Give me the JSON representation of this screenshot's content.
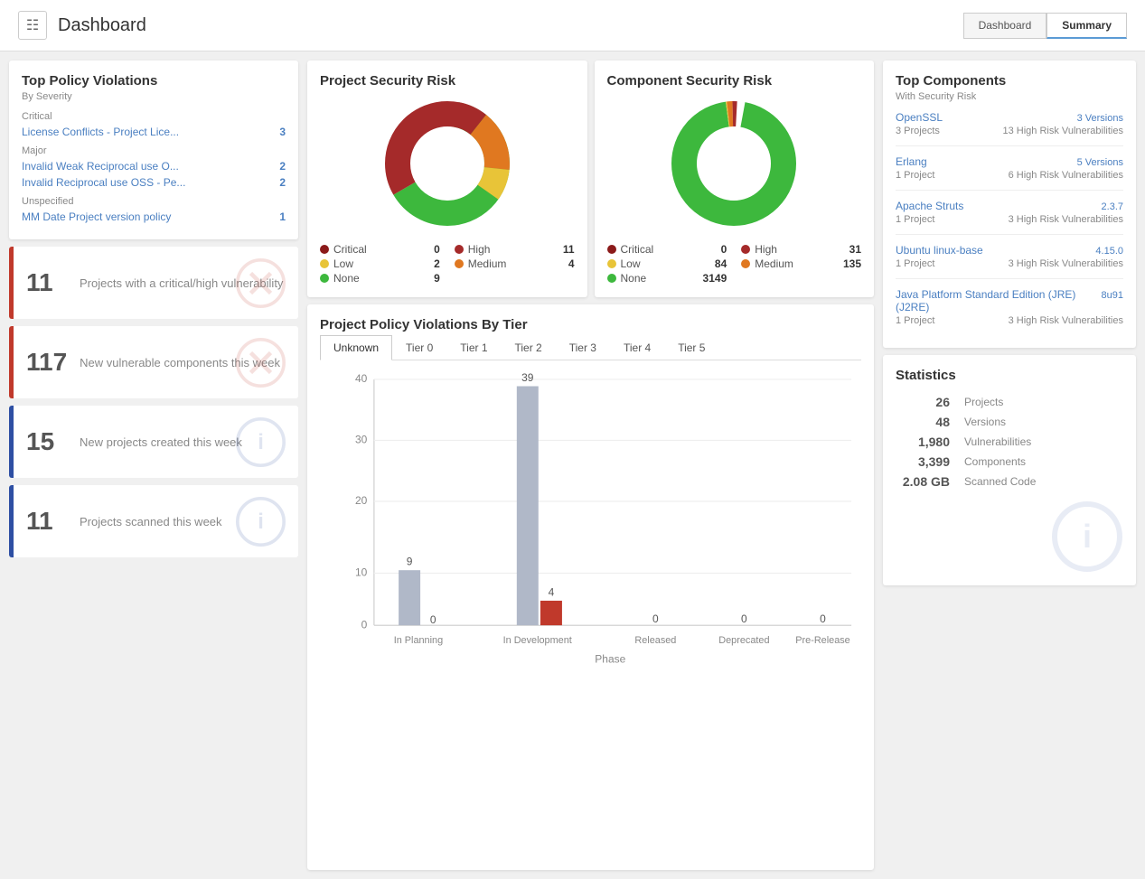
{
  "header": {
    "title": "Dashboard",
    "nav_dashboard": "Dashboard",
    "nav_summary": "Summary"
  },
  "left": {
    "policy_title": "Top Policy Violations",
    "policy_subtitle": "By Severity",
    "severities": [
      {
        "label": "Critical",
        "items": [
          {
            "text": "License Conflicts - Project Lice...",
            "count": "3"
          }
        ]
      },
      {
        "label": "Major",
        "items": [
          {
            "text": "Invalid Weak Reciprocal use O...",
            "count": "2"
          },
          {
            "text": "Invalid Reciprocal use OSS - Pe...",
            "count": "2"
          }
        ]
      },
      {
        "label": "Unspecified",
        "items": [
          {
            "text": "MM Date Project version policy",
            "count": "1"
          }
        ]
      }
    ],
    "stat_cards": [
      {
        "number": "11",
        "label": "Projects with a critical/high vulnerability",
        "type": "red",
        "icon": "x-circle"
      },
      {
        "number": "117",
        "label": "New vulnerable components this week",
        "type": "red",
        "icon": "x-circle"
      },
      {
        "number": "15",
        "label": "New projects created this week",
        "type": "blue",
        "icon": "info-circle"
      },
      {
        "number": "11",
        "label": "Projects scanned this week",
        "type": "blue",
        "icon": "info-circle"
      }
    ]
  },
  "center": {
    "project_risk_title": "Project Security Risk",
    "component_risk_title": "Component Security Risk",
    "project_legend": [
      {
        "color": "#8b1a1a",
        "label": "Critical",
        "value": "0"
      },
      {
        "color": "#a52a2a",
        "label": "High",
        "value": "11"
      },
      {
        "color": "#e8c438",
        "label": "Low",
        "value": "2"
      },
      {
        "color": "#e07820",
        "label": "Medium",
        "value": "4"
      },
      {
        "color": "#3db83d",
        "label": "None",
        "value": "9"
      }
    ],
    "component_legend": [
      {
        "color": "#8b1a1a",
        "label": "Critical",
        "value": "0"
      },
      {
        "color": "#a52a2a",
        "label": "High",
        "value": "31"
      },
      {
        "color": "#e8c438",
        "label": "Low",
        "value": "84"
      },
      {
        "color": "#e07820",
        "label": "Medium",
        "value": "135"
      },
      {
        "color": "#3db83d",
        "label": "None",
        "value": "3149"
      }
    ],
    "violations_title": "Project Policy Violations By Tier",
    "tabs": [
      "Unknown",
      "Tier 0",
      "Tier 1",
      "Tier 2",
      "Tier 3",
      "Tier 4",
      "Tier 5"
    ],
    "active_tab": "Unknown",
    "bar_chart": {
      "y_labels": [
        "0",
        "10",
        "20",
        "30",
        "40"
      ],
      "x_labels": [
        "In Planning",
        "In Development",
        "Released",
        "Deprecated",
        "Pre-Release"
      ],
      "x_sub": "Phase",
      "bars": [
        {
          "phase": "In Planning",
          "gray": 9,
          "red": 0,
          "gray_label": "9",
          "red_label": "0"
        },
        {
          "phase": "In Development",
          "gray": 39,
          "red": 4,
          "gray_label": "39",
          "red_label": "4"
        },
        {
          "phase": "Released",
          "gray": 0,
          "red": 0,
          "gray_label": "0",
          "red_label": ""
        },
        {
          "phase": "Deprecated",
          "gray": 0,
          "red": 0,
          "gray_label": "0",
          "red_label": ""
        },
        {
          "phase": "Pre-Release",
          "gray": 0,
          "red": 0,
          "gray_label": "0",
          "red_label": ""
        }
      ]
    }
  },
  "right": {
    "top_components_title": "Top Components",
    "top_components_subtitle": "With Security Risk",
    "components": [
      {
        "name": "OpenSSL",
        "projects": "3 Projects",
        "version": "3 Versions",
        "vulns": "13 High Risk Vulnerabilities"
      },
      {
        "name": "Erlang",
        "projects": "1 Project",
        "version": "5 Versions",
        "vulns": "6 High Risk Vulnerabilities"
      },
      {
        "name": "Apache Struts",
        "projects": "1 Project",
        "version": "2.3.7",
        "vulns": "3 High Risk Vulnerabilities"
      },
      {
        "name": "Ubuntu linux-base",
        "projects": "1 Project",
        "version": "4.15.0",
        "vulns": "3 High Risk Vulnerabilities"
      },
      {
        "name": "Java Platform Standard Edition (JRE) (J2RE)",
        "projects": "1 Project",
        "version": "8u91",
        "vulns": "3 High Risk Vulnerabilities"
      }
    ],
    "statistics_title": "Statistics",
    "stats": [
      {
        "value": "26",
        "label": "Projects"
      },
      {
        "value": "48",
        "label": "Versions"
      },
      {
        "value": "1,980",
        "label": "Vulnerabilities"
      },
      {
        "value": "3,399",
        "label": "Components"
      },
      {
        "value": "2.08 GB",
        "label": "Scanned Code"
      }
    ]
  }
}
